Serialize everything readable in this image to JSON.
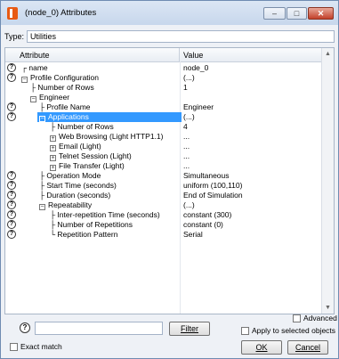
{
  "window": {
    "title": "(node_0) Attributes",
    "minimize_symbol": "–",
    "maximize_symbol": "□",
    "close_symbol": "✕"
  },
  "type": {
    "label": "Type:",
    "value": "Utilities"
  },
  "grid": {
    "columns": {
      "attribute": "Attribute",
      "value": "Value"
    },
    "rows": [
      {
        "attr": "name",
        "value": "node_0"
      },
      {
        "attr": "Profile Configuration",
        "value": "(...)"
      },
      {
        "attr": "Number of Rows",
        "value": "1"
      },
      {
        "attr": "Engineer",
        "value": ""
      },
      {
        "attr": "Profile Name",
        "value": "Engineer"
      },
      {
        "attr": "Applications",
        "value": "(...)"
      },
      {
        "attr": "Number of Rows",
        "value": "4"
      },
      {
        "attr": "Web Browsing (Light HTTP1.1)",
        "value": "..."
      },
      {
        "attr": "Email (Light)",
        "value": "..."
      },
      {
        "attr": "Telnet Session (Light)",
        "value": "..."
      },
      {
        "attr": "File Transfer (Light)",
        "value": "..."
      },
      {
        "attr": "Operation Mode",
        "value": "Simultaneous"
      },
      {
        "attr": "Start Time (seconds)",
        "value": "uniform (100,110)"
      },
      {
        "attr": "Duration (seconds)",
        "value": "End of Simulation"
      },
      {
        "attr": "Repeatability",
        "value": "(...)"
      },
      {
        "attr": "Inter-repetition Time (seconds)",
        "value": "constant (300)"
      },
      {
        "attr": "Number of Repetitions",
        "value": "constant (0)"
      },
      {
        "attr": "Repetition Pattern",
        "value": "Serial"
      }
    ],
    "help_symbol": "?",
    "expand_symbol": "⊞",
    "collapse_symbol": "⊟"
  },
  "footer": {
    "filter_button": "Filter",
    "exact_match": "Exact match",
    "advanced": "Advanced",
    "apply_selected": "Apply to selected objects",
    "ok": "OK",
    "cancel": "Cancel"
  }
}
